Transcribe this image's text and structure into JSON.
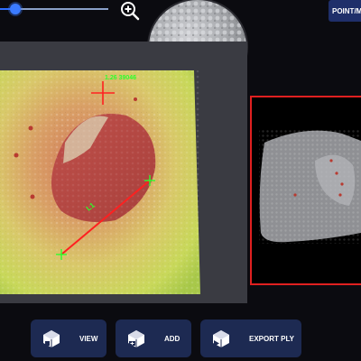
{
  "slider": {
    "value_fraction": 0.14
  },
  "icons": {
    "zoom": "magnifier-plus-icon",
    "view": "cube-view-icon",
    "add": "cube-add-icon",
    "export": "cube-export-icon"
  },
  "header": {
    "mode_label": "POINT/ME"
  },
  "measurement": {
    "point_label": "1.26 39046",
    "line_label": "L1"
  },
  "toolbar": {
    "view_label": "VIEW",
    "add_label": "ADD",
    "export_label": "EXPORT PLY"
  },
  "colors": {
    "accent": "#2f6fff",
    "button_bg": "#1d2a52",
    "selection_frame": "#e02020",
    "measure_line": "#ff2020",
    "marker_green": "#2cff2c"
  }
}
